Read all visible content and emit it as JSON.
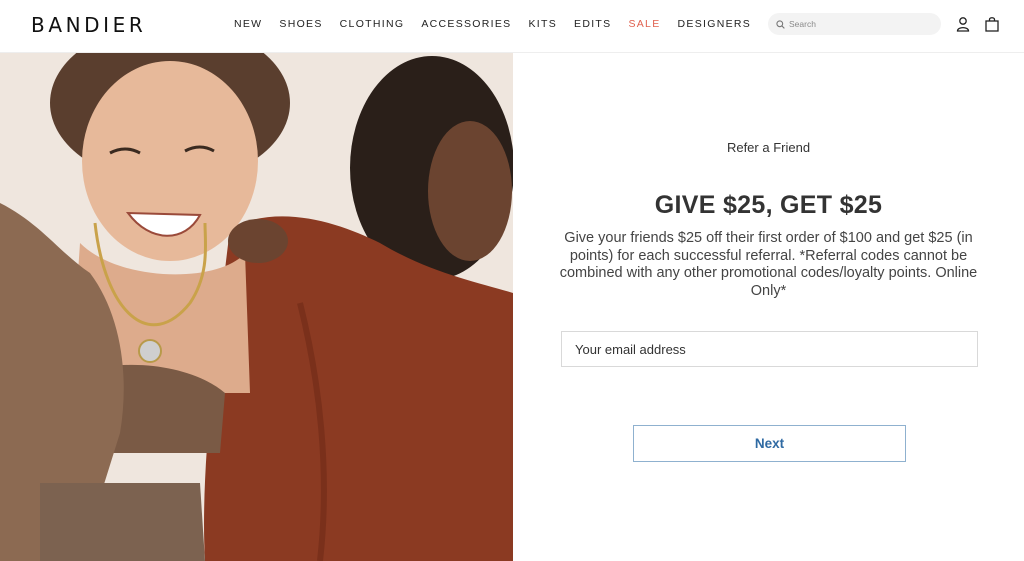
{
  "header": {
    "logo": "BANDIER",
    "nav": [
      "NEW",
      "SHOES",
      "CLOTHING",
      "ACCESSORIES",
      "KITS",
      "EDITS",
      "SALE",
      "DESIGNERS"
    ],
    "sale_color": "#e0614f",
    "search_placeholder": "Search",
    "icons": [
      "search-icon",
      "account-icon",
      "shopping-bag-icon"
    ]
  },
  "promo": {
    "eyebrow": "Refer a Friend",
    "headline": "GIVE $25, GET $25",
    "description": "Give your friends $25 off their first order of $100 and get $25 (in points) for each successful referral. *Referral codes cannot be combined with any other promotional codes/loyalty points. Online Only*",
    "email_placeholder": "Your email address",
    "next_label": "Next",
    "button_color": "#2f6aa3"
  }
}
